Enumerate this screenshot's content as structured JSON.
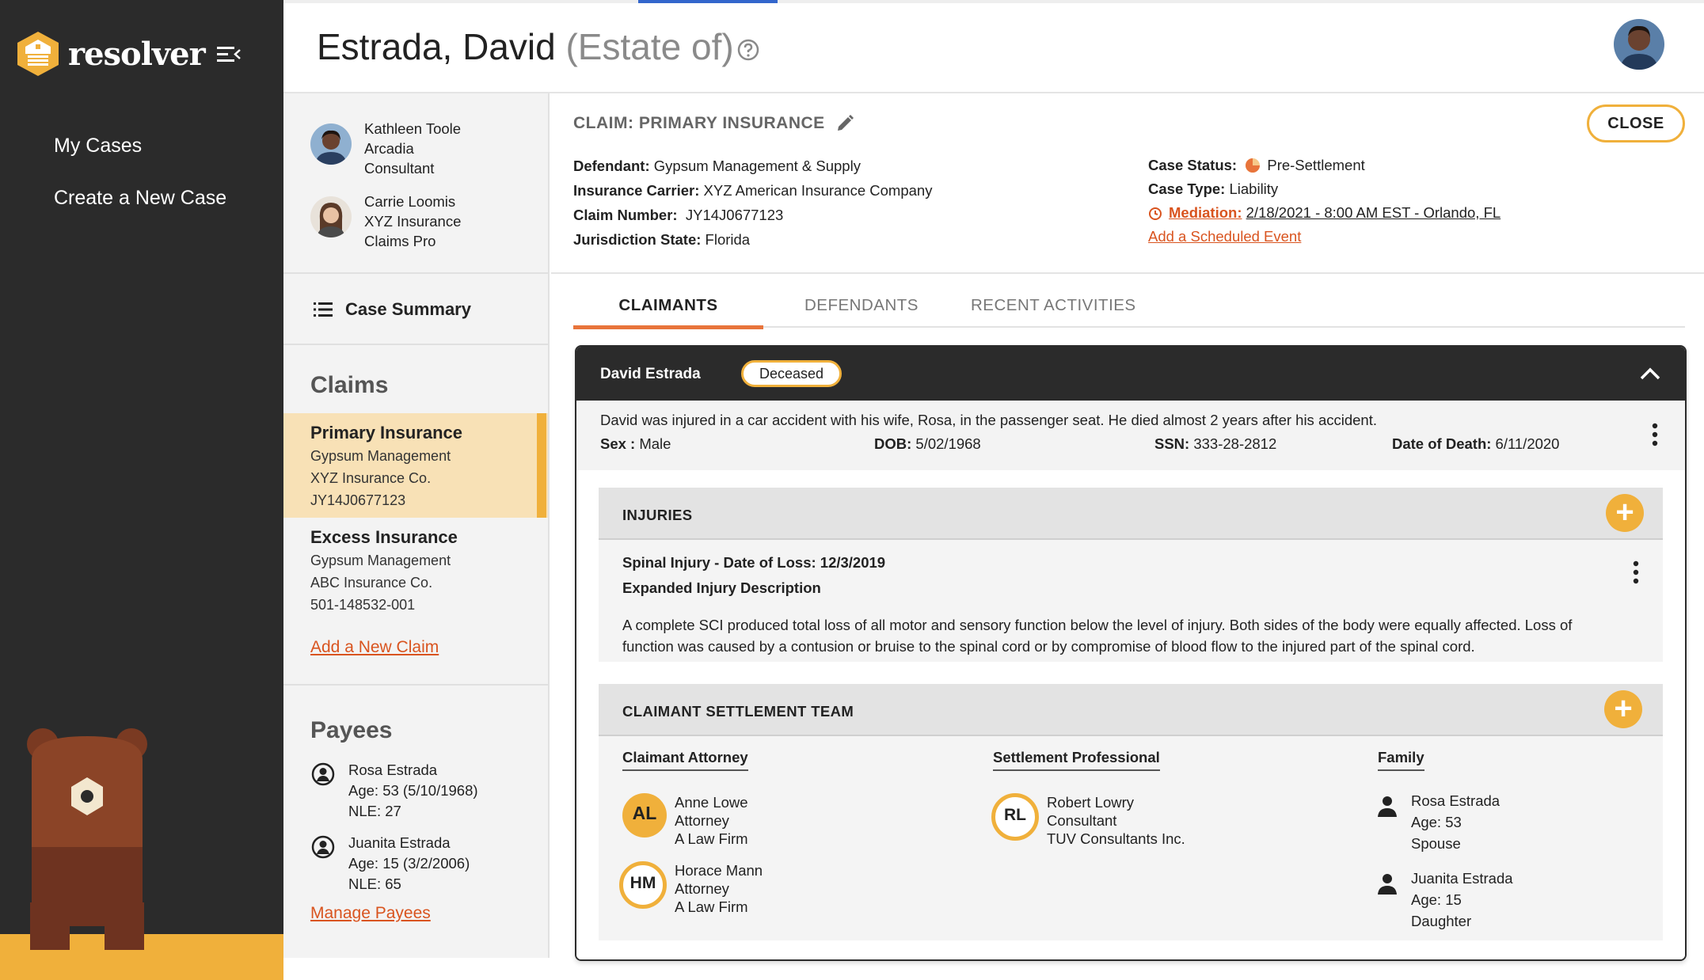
{
  "app": {
    "brand": "resolver",
    "nav": [
      {
        "label": "My Cases"
      },
      {
        "label": "Create a New Case"
      }
    ]
  },
  "header": {
    "name": "Estrada, David",
    "suffix": "(Estate of)"
  },
  "team_contacts": [
    {
      "name": "Kathleen Toole",
      "org": "Arcadia",
      "role": "Consultant"
    },
    {
      "name": "Carrie Loomis",
      "org": "XYZ Insurance",
      "role": "Claims Pro"
    }
  ],
  "left": {
    "case_summary": "Case Summary",
    "claims_title": "Claims",
    "claims": [
      {
        "name": "Primary Insurance",
        "defendant": "Gypsum Management",
        "carrier": "XYZ Insurance Co.",
        "number": "JY14J0677123"
      },
      {
        "name": "Excess Insurance",
        "defendant": "Gypsum Management",
        "carrier": "ABC Insurance Co.",
        "number": "501-148532-001"
      }
    ],
    "add_claim": "Add a New Claim",
    "payees_title": "Payees",
    "payees": [
      {
        "name": "Rosa Estrada",
        "age": "Age: 53 (5/10/1968)",
        "nle": "NLE: 27"
      },
      {
        "name": "Juanita Estrada",
        "age": "Age: 15 (3/2/2006)",
        "nle": "NLE: 65"
      }
    ],
    "manage_payees": "Manage Payees"
  },
  "claim": {
    "heading": "CLAIM: PRIMARY INSURANCE",
    "close": "CLOSE",
    "defendant_label": "Defendant:",
    "defendant": "Gypsum Management & Supply",
    "carrier_label": "Insurance Carrier:",
    "carrier": "XYZ American Insurance Company",
    "number_label": "Claim Number:",
    "number": "JY14J0677123",
    "jurisdiction_label": "Jurisdiction State:",
    "jurisdiction": "Florida",
    "status_label": "Case Status:",
    "status": "Pre-Settlement",
    "type_label": "Case Type:",
    "type": "Liability",
    "mediation_label": "Mediation:",
    "mediation": "2/18/2021 - 8:00 AM EST - Orlando, FL",
    "add_event": "Add a Scheduled Event"
  },
  "tabs": [
    {
      "label": "CLAIMANTS"
    },
    {
      "label": "DEFENDANTS"
    },
    {
      "label": "RECENT ACTIVITIES"
    }
  ],
  "claimant": {
    "name": "David Estrada",
    "badge": "Deceased",
    "description": "David was injured in a car accident with his wife, Rosa, in the passenger seat. He died almost 2 years after his accident.",
    "sex_label": "Sex :",
    "sex": "Male",
    "dob_label": "DOB:",
    "dob": "5/02/1968",
    "ssn_label": "SSN:",
    "ssn": "333-28-2812",
    "dod_label": "Date of Death:",
    "dod": "6/11/2020"
  },
  "injuries": {
    "title": "INJURIES",
    "injury_title": "Spinal Injury -  Date of Loss: 12/3/2019",
    "expanded_label": "Expanded Injury Description",
    "text": "A complete SCI produced total loss of all motor and sensory function below the level of injury.  Both sides of the body were equally affected. Loss of function was caused by a contusion or bruise to the spinal cord or by compromise of blood flow to the injured part of the spinal cord."
  },
  "settlement_team": {
    "title": "CLAIMANT SETTLEMENT TEAM",
    "attorney_col": "Claimant Attorney",
    "professional_col": "Settlement Professional",
    "family_col": "Family",
    "attorneys": [
      {
        "initials": "AL",
        "name": "Anne Lowe",
        "role": "Attorney",
        "firm": "A Law Firm"
      },
      {
        "initials": "HM",
        "name": "Horace Mann",
        "role": "Attorney",
        "firm": "A Law Firm"
      }
    ],
    "professionals": [
      {
        "initials": "RL",
        "name": "Robert Lowry",
        "role": "Consultant",
        "firm": "TUV Consultants Inc."
      }
    ],
    "family": [
      {
        "name": "Rosa Estrada",
        "age": "Age: 53",
        "relation": "Spouse"
      },
      {
        "name": "Juanita Estrada",
        "age": "Age: 15",
        "relation": "Daughter"
      }
    ]
  },
  "colors": {
    "accent": "#f0b03b",
    "link": "#d9541f",
    "tab_underline": "#e8743b",
    "nav_bg": "#2b2b2b"
  },
  "icons": [
    "resolver-logo-icon",
    "menu-collapse-icon",
    "help-icon",
    "edit-pencil-icon",
    "list-icon",
    "person-circle-icon",
    "status-pie-icon",
    "alarm-clock-icon",
    "chevron-up-icon",
    "kebab-icon",
    "plus-icon",
    "person-icon",
    "bear-mascot-icon"
  ]
}
